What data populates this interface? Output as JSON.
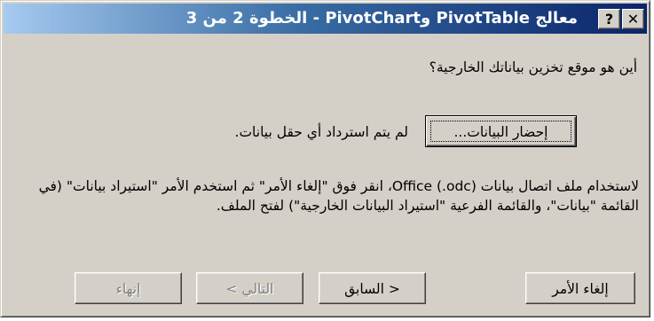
{
  "window": {
    "title": "معالج PivotTable وPivotChart  - الخطوة 2 من 3",
    "help_label": "?",
    "close_label": "✕"
  },
  "content": {
    "question": "أين هو موقع تخزين بياناتك الخارجية؟",
    "get_data_label": "إحضار البيانات...",
    "status_text": "لم يتم استرداد أي حقل بيانات.",
    "instructions": "لاستخدام ملف اتصال بيانات Office (.odc)، انقر فوق \"إلغاء الأمر\" ثم استخدم الأمر \"استيراد بيانات\" (في القائمة \"بيانات\"، والقائمة الفرعية \"استيراد البيانات الخارجية\") لفتح الملف."
  },
  "buttons": {
    "cancel": "إلغاء الأمر",
    "back": "< السابق",
    "next": "التالي >",
    "finish": "إنهاء"
  }
}
